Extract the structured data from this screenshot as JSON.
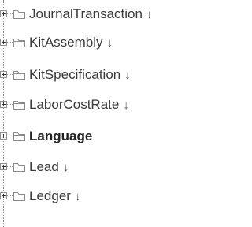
{
  "tree": {
    "items": [
      {
        "label": "JournalTransaction",
        "arrow": "↓",
        "bold": false
      },
      {
        "label": "KitAssembly",
        "arrow": "↓",
        "bold": false
      },
      {
        "label": "KitSpecification",
        "arrow": "↓",
        "bold": false
      },
      {
        "label": "LaborCostRate",
        "arrow": "↓",
        "bold": false
      },
      {
        "label": "Language",
        "arrow": "",
        "bold": true
      },
      {
        "label": "Lead",
        "arrow": "↓",
        "bold": false
      },
      {
        "label": "Ledger",
        "arrow": "↓",
        "bold": false
      }
    ]
  },
  "colors": {
    "text": "#3a3a3a",
    "folder_stroke": "#8a8a8a",
    "connector": "#8c8c8c"
  },
  "icons": {
    "expander": "plus-box-icon",
    "folder": "folder-icon"
  }
}
